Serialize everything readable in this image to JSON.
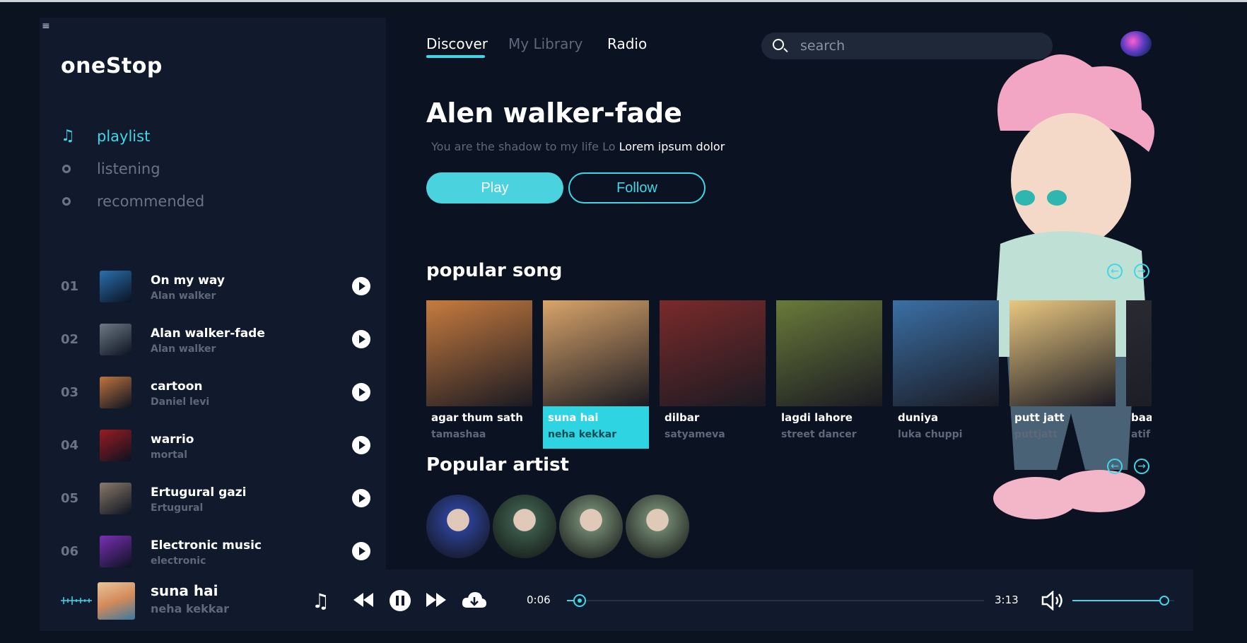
{
  "app": {
    "brand": "oneStop"
  },
  "sidebar": {
    "nav": [
      {
        "label": "playlist",
        "active": true,
        "icon": "music-note-icon"
      },
      {
        "label": "listening",
        "active": false,
        "icon": "circle-icon"
      },
      {
        "label": "recommended",
        "active": false,
        "icon": "circle-icon"
      }
    ],
    "tracks": [
      {
        "num": "01",
        "title": "On my way",
        "artist": "Alan walker",
        "color": "#2a6fb0"
      },
      {
        "num": "02",
        "title": "Alan walker-fade",
        "artist": "Alan walker",
        "color": "#6e7985"
      },
      {
        "num": "03",
        "title": "cartoon",
        "artist": "Daniel levi",
        "color": "#c0743f"
      },
      {
        "num": "04",
        "title": "warrio",
        "artist": "mortal",
        "color": "#9a1b22"
      },
      {
        "num": "05",
        "title": "Ertugural gazi",
        "artist": "Ertugural",
        "color": "#8b7a6a"
      },
      {
        "num": "06",
        "title": "Electronic music",
        "artist": "electronic",
        "color": "#7b2fb5"
      }
    ]
  },
  "header": {
    "tabs": [
      {
        "label": "Discover",
        "active": true
      },
      {
        "label": "My Library",
        "active": false
      },
      {
        "label": "Radio",
        "active": false
      }
    ],
    "search": {
      "placeholder": "search"
    }
  },
  "hero": {
    "title": "Alen walker-fade",
    "subtitle_muted": "You are the shadow to my life Lo",
    "subtitle_bright": "Lorem ipsum dolor",
    "play_label": "Play",
    "follow_label": "Follow"
  },
  "popular_songs": {
    "heading": "popular song",
    "items": [
      {
        "title": "agar thum sath",
        "subtitle": "tamashaa",
        "color": "#c77b3e",
        "selected": false
      },
      {
        "title": "suna hai",
        "subtitle": "neha kekkar",
        "color": "#d9a46a",
        "selected": true
      },
      {
        "title": "dilbar",
        "subtitle": "satyameva",
        "color": "#7a2a2a",
        "selected": false
      },
      {
        "title": "lagdi lahore",
        "subtitle": "street dancer",
        "color": "#6a7a3a",
        "selected": false
      },
      {
        "title": "duniya",
        "subtitle": "luka chuppi",
        "color": "#3a6fa5",
        "selected": false
      },
      {
        "title": "putt jatt",
        "subtitle": "puttjatt",
        "color": "#e9c780",
        "selected": false
      },
      {
        "title": "baa",
        "subtitle": "atif c",
        "color": "#2a2a32",
        "selected": false
      }
    ]
  },
  "popular_artists": {
    "heading": "Popular artist",
    "items": [
      {
        "color": "#2b3f8f"
      },
      {
        "color": "#3a5a4a"
      },
      {
        "color": "#6a7f6a"
      },
      {
        "color": "#6a7f6a"
      }
    ]
  },
  "player": {
    "title": "suna hai",
    "artist": "neha kekkar",
    "current_time": "0:06",
    "total_time": "3:13",
    "progress": 0.03,
    "volume": 0.9
  },
  "colors": {
    "accent": "#3fd7e6",
    "bg": "#0b1220"
  }
}
